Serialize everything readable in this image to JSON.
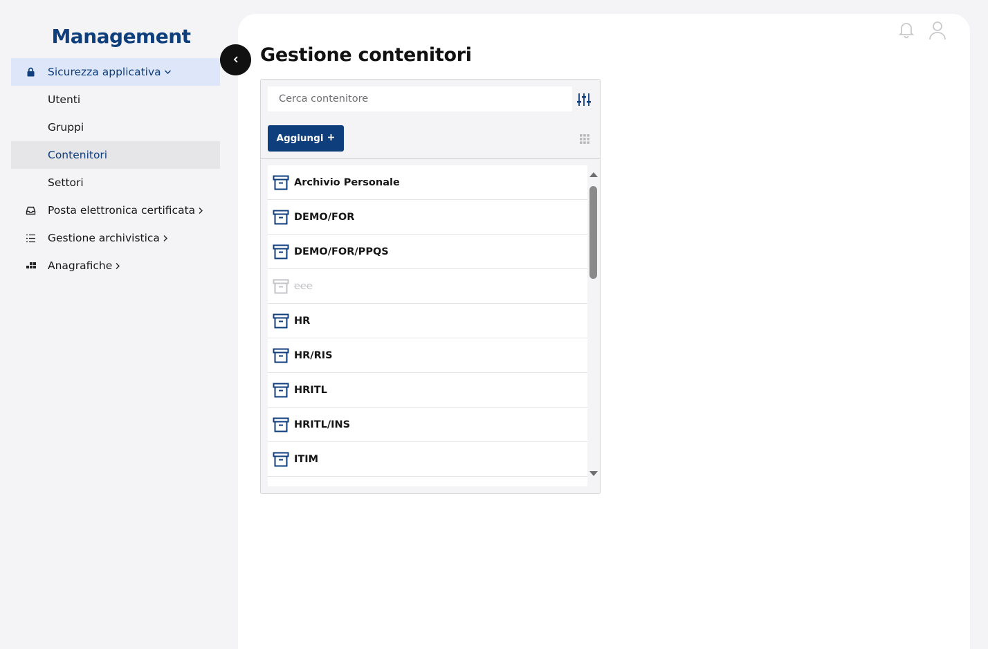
{
  "sidebar": {
    "brand": "Management",
    "items": [
      {
        "label": "Sicurezza applicativa",
        "icon": "lock-icon"
      },
      {
        "label": "Utenti"
      },
      {
        "label": "Gruppi"
      },
      {
        "label": "Contenitori"
      },
      {
        "label": "Settori"
      },
      {
        "label": "Posta elettronica certificata",
        "icon": "inbox-icon"
      },
      {
        "label": "Gestione archivistica",
        "icon": "list-icon"
      },
      {
        "label": "Anagrafiche",
        "icon": "apps-icon"
      }
    ]
  },
  "main": {
    "title": "Gestione contenitori",
    "search": {
      "placeholder": "Cerca contenitore",
      "value": ""
    },
    "add_label": "Aggiungi",
    "list": [
      {
        "label": "Archivio Personale",
        "disabled": false
      },
      {
        "label": "DEMO/FOR",
        "disabled": false
      },
      {
        "label": "DEMO/FOR/PPQS",
        "disabled": false
      },
      {
        "label": "eee",
        "disabled": true
      },
      {
        "label": "HR",
        "disabled": false
      },
      {
        "label": "HR/RIS",
        "disabled": false
      },
      {
        "label": "HRITL",
        "disabled": false
      },
      {
        "label": "HRITL/INS",
        "disabled": false
      },
      {
        "label": "ITIM",
        "disabled": false
      }
    ]
  },
  "colors": {
    "brand": "#0f3e7d",
    "active_parent_bg": "#dde7f9",
    "selected_bg": "#e6e6e9",
    "disabled_text": "#c4c4c8"
  }
}
